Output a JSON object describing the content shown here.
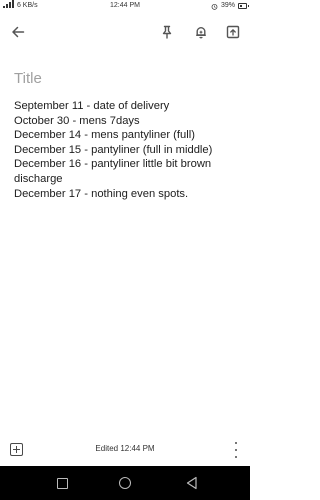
{
  "status_bar": {
    "network_speed": "6 KB/s",
    "time": "12:44 PM",
    "battery": "39%",
    "battery_level_percent": 39
  },
  "toolbar": {
    "icons": [
      "back-arrow-icon",
      "pin-icon",
      "reminder-bell-icon",
      "archive-icon"
    ]
  },
  "note": {
    "title_placeholder": "Title",
    "lines": [
      "September 11 - date of delivery",
      "October 30 - mens 7days",
      "December 14 -  mens pantyliner (full)",
      "December 15 - pantyliner (full in middle)",
      "December 16 - pantyliner little bit brown",
      "discharge",
      "December 17 - nothing even spots."
    ]
  },
  "bottom_bar": {
    "edited_text": "Edited 12:44 PM"
  },
  "nav_bar": {
    "buttons": [
      "recents-square",
      "home-circle",
      "back-triangle"
    ]
  },
  "colors": {
    "background": "#ffffff",
    "text": "#202020",
    "placeholder": "#a0a0a0",
    "nav_bar": "#000000"
  }
}
